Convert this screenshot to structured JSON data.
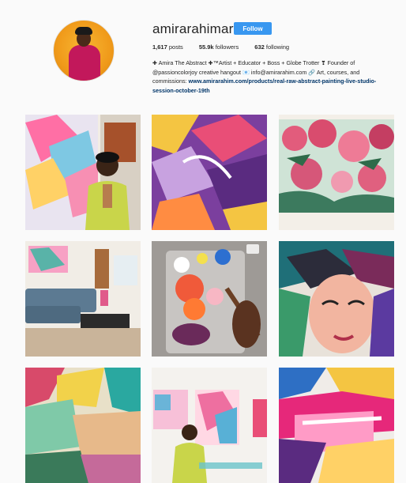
{
  "profile": {
    "username": "amirarahimart",
    "follow_label": "Follow",
    "stats": {
      "posts_count": "1,617",
      "posts_label": "posts",
      "followers_count": "55.9k",
      "followers_label": "followers",
      "following_count": "632",
      "following_label": "following"
    },
    "bio": {
      "line1": "✚ Amira The Abstract ✚™Artist + Educator + Boss + Globe Trotter ❣ Founder of",
      "line2": "@passioncolorjoy creative hangout 📧 info@amirarahim.com 🔗 Art, courses, and",
      "line3_prefix": "commissions: ",
      "link_text": "www.amirarahim.com/products/real-raw-abstract-painting-live-studio-session-october-19th"
    }
  },
  "colors": {
    "accent": "#3897f0",
    "link": "#003569",
    "background": "#fafafa"
  },
  "grid": {
    "posts": [
      {
        "name": "artist-with-painting"
      },
      {
        "name": "purple-abstract-closeup"
      },
      {
        "name": "pink-roses-painting"
      },
      {
        "name": "living-room-with-art"
      },
      {
        "name": "palette-and-brush"
      },
      {
        "name": "abstract-face-portrait"
      },
      {
        "name": "green-abstract-closeup"
      },
      {
        "name": "artist-standing-studio"
      },
      {
        "name": "magenta-abstract-closeup"
      }
    ]
  }
}
